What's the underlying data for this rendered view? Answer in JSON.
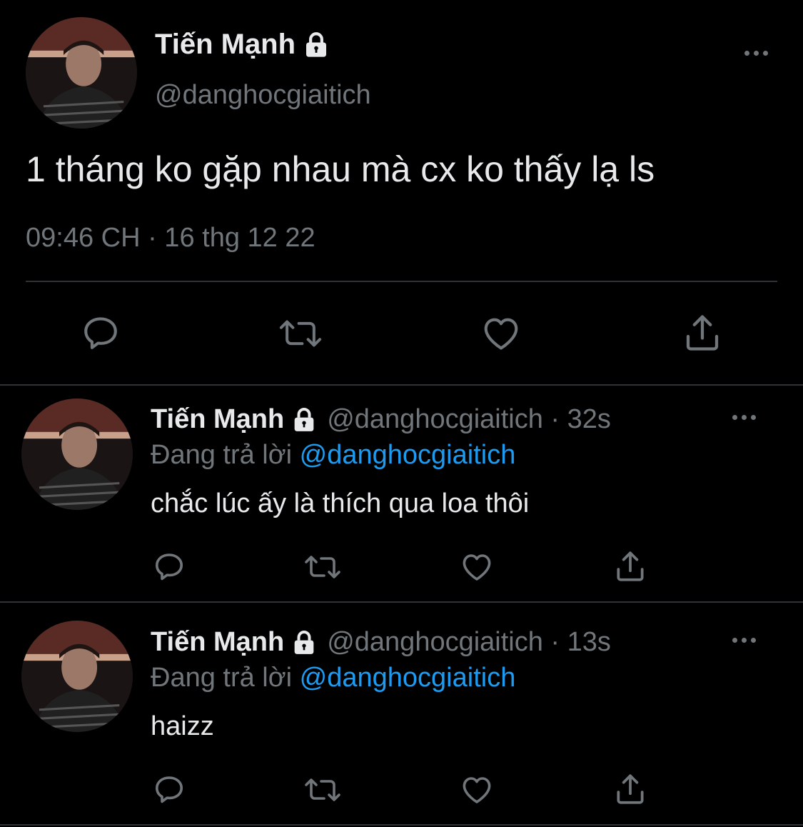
{
  "main_tweet": {
    "author_name": "Tiến Mạnh",
    "handle": "@danghocgiaitich",
    "text": "1 tháng ko gặp nhau mà cx ko thấy lạ ls",
    "timestamp": "09:46 CH · 16 thg 12 22",
    "icons": {
      "lock": "lock-icon",
      "more": "more-icon",
      "reply": "reply-icon",
      "retweet": "retweet-icon",
      "like": "heart-icon",
      "share": "share-icon"
    }
  },
  "replies": [
    {
      "author_name": "Tiến Mạnh",
      "handle_time": "@danghocgiaitich · 32s",
      "replying_label": "Đang trả lời",
      "replying_to": "@danghocgiaitich",
      "text": "chắc lúc ấy là thích qua loa thôi"
    },
    {
      "author_name": "Tiến Mạnh",
      "handle_time": "@danghocgiaitich · 13s",
      "replying_label": "Đang trả lời",
      "replying_to": "@danghocgiaitich",
      "text": "haizz"
    }
  ],
  "colors": {
    "background": "#000000",
    "text_primary": "#E7E9EA",
    "text_secondary": "#71767B",
    "link": "#1D9BF0",
    "divider": "#2F3336"
  }
}
